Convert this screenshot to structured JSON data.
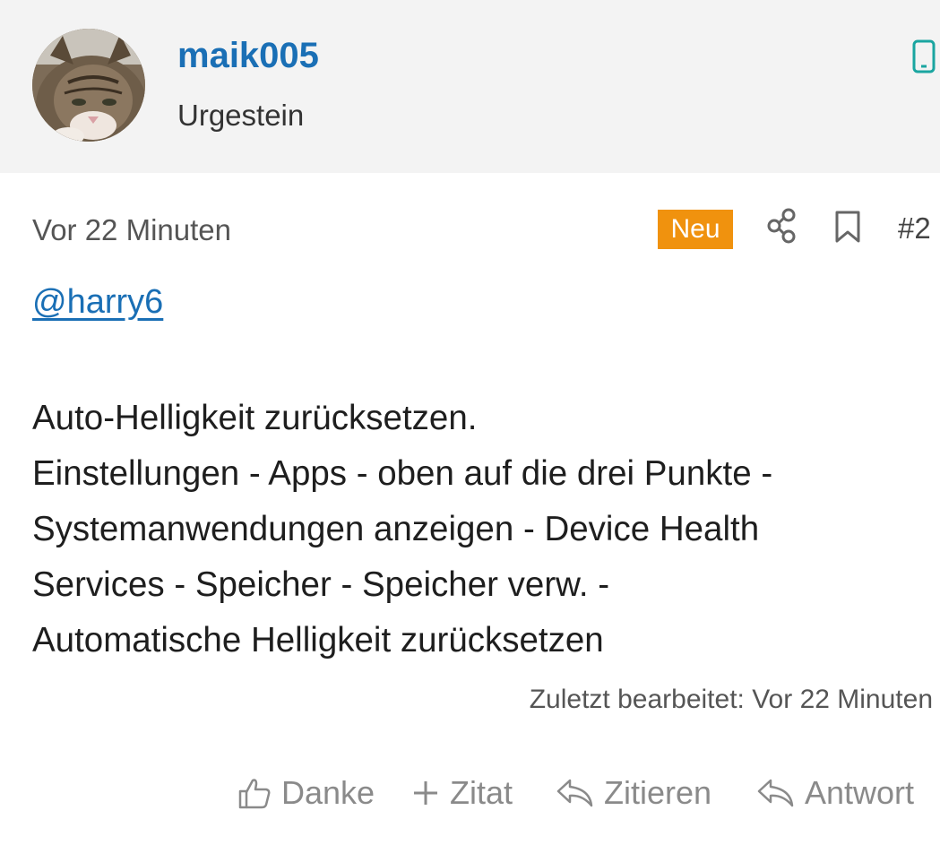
{
  "author": {
    "username": "maik005",
    "rank": "Urgestein"
  },
  "post": {
    "timestamp": "Vor 22 Minuten",
    "badge": "Neu",
    "number": "#2",
    "mention": "@harry6",
    "lines": [
      "Auto-Helligkeit zurücksetzen.",
      "Einstellungen - Apps - oben auf die drei Punkte -",
      "Systemanwendungen anzeigen - Device Health",
      "Services - Speicher - Speicher verw. -",
      "Automatische Helligkeit zurücksetzen"
    ],
    "edited": "Zuletzt bearbeitet: Vor 22 Minuten"
  },
  "actions": {
    "thanks": "Danke",
    "quote_add": "Zitat",
    "quote": "Zitieren",
    "reply": "Antwort"
  },
  "icons": {
    "device": "mobile-device-icon",
    "share": "share-icon",
    "bookmark": "bookmark-icon",
    "thumbs_up": "thumbs-up-icon",
    "plus": "plus-icon",
    "reply": "reply-arrow-icon"
  },
  "colors": {
    "link": "#1a6fb5",
    "badge": "#f0920e",
    "header_bg": "#f3f3f3",
    "device_icon": "#1aa5a0",
    "action_text": "#8a8a8a"
  }
}
